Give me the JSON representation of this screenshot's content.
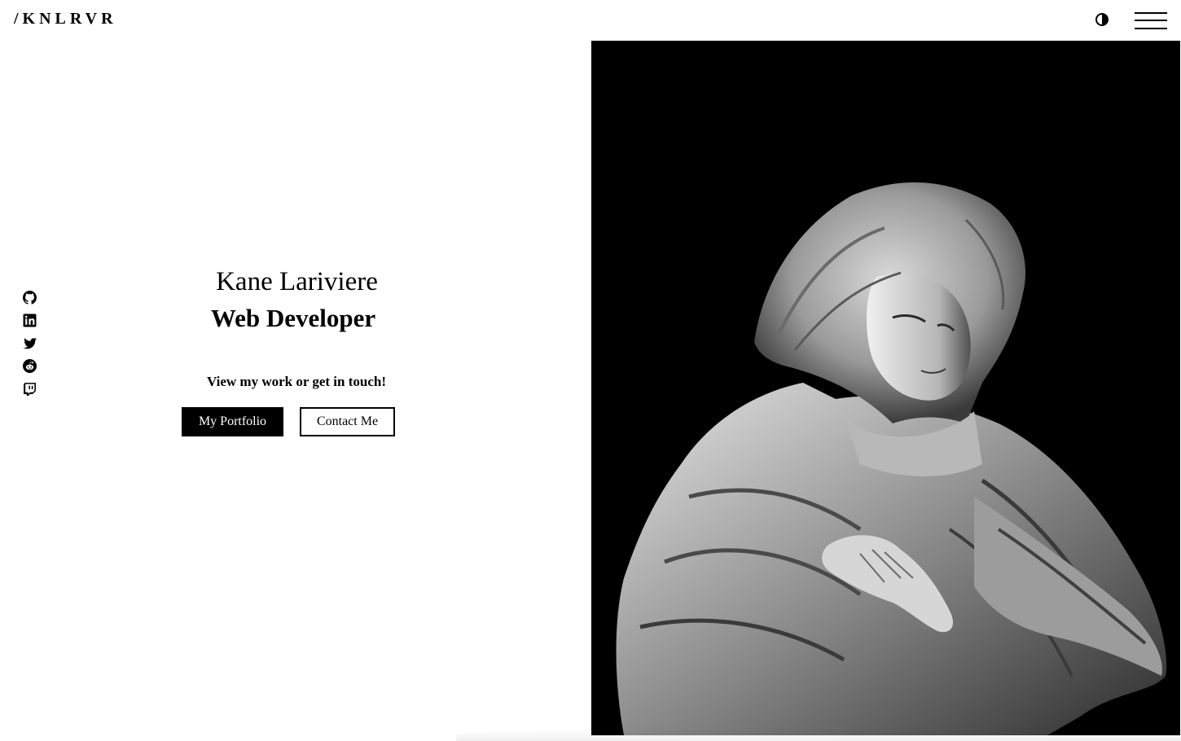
{
  "header": {
    "logo": "/KNLRVR",
    "theme_toggle_icon": "half-circle-contrast-icon",
    "menu_icon": "hamburger-menu-icon"
  },
  "socials": [
    {
      "name": "github",
      "icon": "github-icon"
    },
    {
      "name": "linkedin",
      "icon": "linkedin-icon"
    },
    {
      "name": "twitter",
      "icon": "twitter-icon"
    },
    {
      "name": "reddit",
      "icon": "reddit-icon"
    },
    {
      "name": "twitch",
      "icon": "twitch-icon"
    }
  ],
  "hero": {
    "name": "Kane Lariviere",
    "role": "Web Developer",
    "cta_text": "View my work or get in touch!",
    "primary_button": "My Portfolio",
    "secondary_button": "Contact Me"
  },
  "image": {
    "subject": "marble-statue-image"
  },
  "colors": {
    "background": "#ffffff",
    "text": "#000000",
    "image_background": "#000000"
  }
}
